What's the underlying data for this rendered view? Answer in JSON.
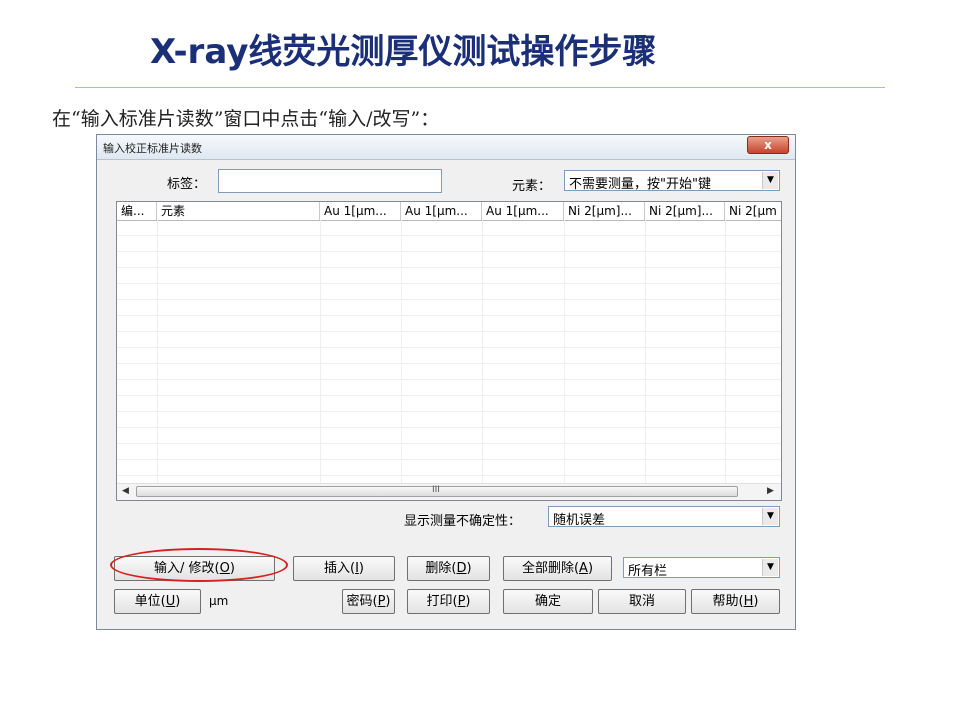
{
  "slide": {
    "title": "X-ray线荧光测厚仪测试操作步骤",
    "instruction": "在“输入标准片读数”窗口中点击“输入/改写”："
  },
  "dialog": {
    "title": "输入校正标准片读数",
    "close_label": "x",
    "tag_label": "标签：",
    "tag_value": "",
    "element_label": "元素：",
    "element_value": "不需要测量，按\"开始\"键",
    "columns": [
      "编...",
      "元素",
      "Au 1[µm...",
      "Au 1[µm...",
      "Au 1[µm...",
      "Ni 2[µm]...",
      "Ni 2[µm]...",
      "Ni 2[µm"
    ],
    "scroll_grip": "III",
    "uncertainty_label": "显示测量不确定性：",
    "uncertainty_value": "随机误差",
    "column_filter_value": "所有栏",
    "unit_value": "µm",
    "buttons": {
      "input_modify": {
        "text": "输入/ 修改(",
        "key": "O",
        "end": ")"
      },
      "insert": {
        "text": "插入(",
        "key": "I",
        "end": ")"
      },
      "delete": {
        "text": "删除(",
        "key": "D",
        "end": ")"
      },
      "delete_all": {
        "text": "全部删除(",
        "key": "A",
        "end": ")"
      },
      "unit": {
        "text": "单位(",
        "key": "U",
        "end": ")"
      },
      "password": {
        "text": "密码(",
        "key": "P",
        "end": ")"
      },
      "print": {
        "text": "打印(",
        "key": "P",
        "end": ")"
      },
      "ok": {
        "text": "确定"
      },
      "cancel": {
        "text": "取消"
      },
      "help": {
        "text": "帮助(",
        "key": "H",
        "end": ")"
      }
    }
  },
  "colors": {
    "title": "#1a2f78",
    "rule": "#a4d65e",
    "highlight": "#d62020"
  },
  "icons": [
    "close-icon",
    "dropdown-arrow-icon",
    "scroll-left-icon",
    "scroll-right-icon"
  ]
}
